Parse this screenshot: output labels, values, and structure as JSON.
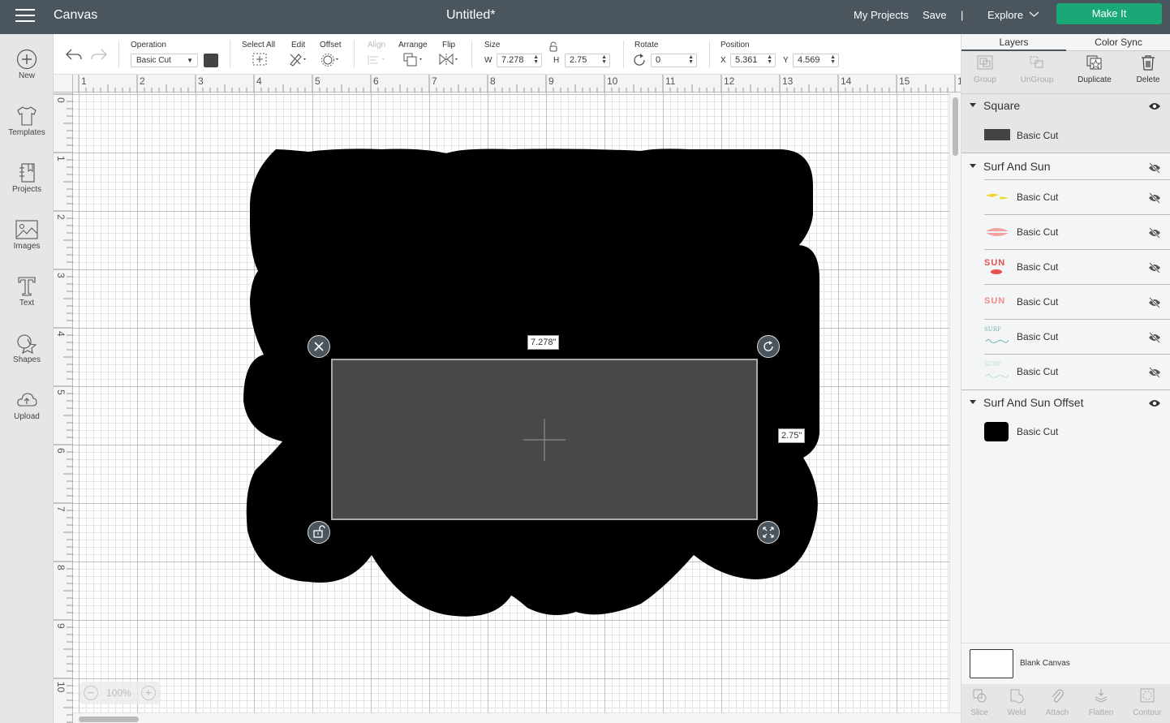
{
  "topbar": {
    "app_title": "Canvas",
    "doc_title": "Untitled*",
    "my_projects": "My Projects",
    "save": "Save",
    "divider": "|",
    "explore": "Explore",
    "make_it": "Make It",
    "make_it_color": "#1aa876"
  },
  "sidebar": {
    "items": [
      {
        "label": "New",
        "icon": "plus-circle-icon"
      },
      {
        "label": "Templates",
        "icon": "tshirt-icon"
      },
      {
        "label": "Projects",
        "icon": "notebook-icon"
      },
      {
        "label": "Images",
        "icon": "image-icon"
      },
      {
        "label": "Text",
        "icon": "text-icon"
      },
      {
        "label": "Shapes",
        "icon": "shapes-icon"
      },
      {
        "label": "Upload",
        "icon": "cloud-upload-icon"
      }
    ]
  },
  "toolbar": {
    "operation_label": "Operation",
    "operation_value": "Basic Cut",
    "color_swatch": "#444444",
    "select_all": "Select All",
    "edit": "Edit",
    "offset": "Offset",
    "align": "Align",
    "arrange": "Arrange",
    "flip": "Flip",
    "size_label": "Size",
    "w_label": "W",
    "w_value": "7.278",
    "h_label": "H",
    "h_value": "2.75",
    "rotate_label": "Rotate",
    "rotate_value": "0",
    "position_label": "Position",
    "x_label": "X",
    "x_value": "5.361",
    "y_label": "Y",
    "y_value": "4.569"
  },
  "rulers": {
    "horizontal": [
      "1",
      "2",
      "3",
      "4",
      "5",
      "6",
      "7",
      "8",
      "9",
      "10",
      "11",
      "12",
      "13",
      "14",
      "15",
      "1"
    ],
    "vertical": [
      "0",
      "1",
      "2",
      "3",
      "4",
      "5",
      "6",
      "7",
      "8",
      "9",
      "10"
    ]
  },
  "canvas": {
    "width_label": "7.278\"",
    "height_label": "2.75\"",
    "zoom": "100%",
    "zoom_minus": "−",
    "zoom_plus": "+"
  },
  "panel": {
    "tabs": [
      "Layers",
      "Color Sync"
    ],
    "tools": [
      {
        "label": "Group",
        "enabled": false
      },
      {
        "label": "UnGroup",
        "enabled": false
      },
      {
        "label": "Duplicate",
        "enabled": true
      },
      {
        "label": "Delete",
        "enabled": true
      }
    ],
    "groups": [
      {
        "name": "Square",
        "visible": true,
        "layers": [
          {
            "name": "Basic Cut",
            "thumb": "dark-rect",
            "visible": true
          }
        ]
      },
      {
        "name": "Surf And Sun",
        "visible": false,
        "layers": [
          {
            "name": "Basic Cut",
            "thumb": "yellow-shapes",
            "visible": false
          },
          {
            "name": "Basic Cut",
            "thumb": "pink-shapes",
            "visible": false
          },
          {
            "name": "Basic Cut",
            "thumb": "sun-red",
            "visible": false
          },
          {
            "name": "Basic Cut",
            "thumb": "sun-pink",
            "visible": false
          },
          {
            "name": "Basic Cut",
            "thumb": "surf-teal",
            "visible": false
          },
          {
            "name": "Basic Cut",
            "thumb": "surf-light",
            "visible": false
          }
        ]
      },
      {
        "name": "Surf And Sun Offset",
        "visible": true,
        "layers": [
          {
            "name": "Basic Cut",
            "thumb": "black-offset",
            "visible": true
          }
        ]
      }
    ],
    "blank_canvas": "Blank Canvas",
    "bottom_tools": [
      "Slice",
      "Weld",
      "Attach",
      "Flatten",
      "Contour"
    ],
    "thumb_text_sun": "SUN",
    "thumb_text_surf": "SURF"
  }
}
